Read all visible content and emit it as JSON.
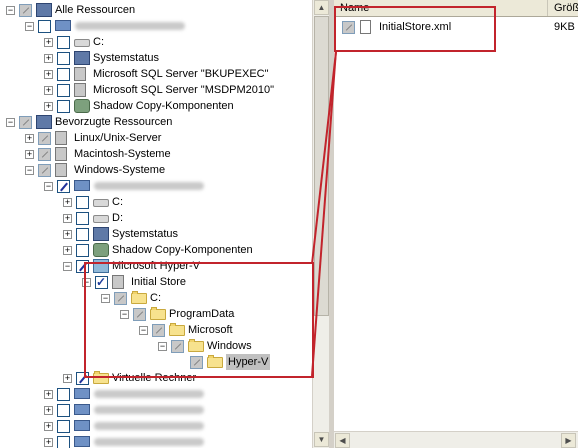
{
  "tree": {
    "nodes": [
      {
        "label": "Alle Ressourcen",
        "expander": "−",
        "check": "gray",
        "icon": "resources-icon"
      },
      {
        "label": "",
        "blurred": true,
        "expander": "−",
        "check": "empty",
        "icon": "computer-icon"
      },
      {
        "label": "C:",
        "expander": "+",
        "check": "empty",
        "icon": "drive-icon"
      },
      {
        "label": "Systemstatus",
        "expander": "+",
        "check": "empty",
        "icon": "system-state-icon"
      },
      {
        "label": "Microsoft SQL Server \"BKUPEXEC\"",
        "expander": "+",
        "check": "empty",
        "icon": "sql-server-icon"
      },
      {
        "label": "Microsoft SQL Server \"MSDPM2010\"",
        "expander": "+",
        "check": "empty",
        "icon": "sql-server-icon"
      },
      {
        "label": "Shadow Copy-Komponenten",
        "expander": "+",
        "check": "empty",
        "icon": "shadow-copy-icon"
      },
      {
        "label": "Bevorzugte Ressourcen",
        "expander": "−",
        "check": "gray",
        "icon": "resources-icon"
      },
      {
        "label": "Linux/Unix-Server",
        "expander": "+",
        "check": "gray",
        "icon": "server-icon"
      },
      {
        "label": "Macintosh-Systeme",
        "expander": "+",
        "check": "gray",
        "icon": "server-icon"
      },
      {
        "label": "Windows-Systeme",
        "expander": "−",
        "check": "gray",
        "icon": "server-icon"
      },
      {
        "label": "",
        "blurred": true,
        "expander": "−",
        "check": "slash",
        "icon": "computer-icon"
      },
      {
        "label": "C:",
        "expander": "+",
        "check": "empty",
        "icon": "drive-icon"
      },
      {
        "label": "D:",
        "expander": "+",
        "check": "empty",
        "icon": "drive-icon"
      },
      {
        "label": "Systemstatus",
        "expander": "+",
        "check": "empty",
        "icon": "system-state-icon"
      },
      {
        "label": "Shadow Copy-Komponenten",
        "expander": "+",
        "check": "empty",
        "icon": "shadow-copy-icon"
      },
      {
        "label": "Microsoft Hyper-V",
        "expander": "−",
        "check": "slash",
        "icon": "hyperv-icon"
      },
      {
        "label": "Initial Store",
        "expander": "−",
        "check": "checked",
        "icon": "store-icon"
      },
      {
        "label": "C:",
        "expander": "−",
        "check": "gray",
        "icon": "folder-icon"
      },
      {
        "label": "ProgramData",
        "expander": "−",
        "check": "gray",
        "icon": "folder-icon"
      },
      {
        "label": "Microsoft",
        "expander": "−",
        "check": "gray",
        "icon": "folder-icon"
      },
      {
        "label": "Windows",
        "expander": "−",
        "check": "gray",
        "icon": "folder-icon"
      },
      {
        "label": "Hyper-V",
        "expander": "",
        "check": "gray",
        "icon": "folder-icon",
        "selected": true
      },
      {
        "label": "Virtuelle Rechner",
        "expander": "+",
        "check": "slash",
        "icon": "folder-icon"
      },
      {
        "label": "",
        "blurred": true,
        "expander": "+",
        "check": "empty",
        "icon": "computer-icon"
      },
      {
        "label": "",
        "blurred": true,
        "expander": "+",
        "check": "empty",
        "icon": "computer-icon"
      },
      {
        "label": "",
        "blurred": true,
        "expander": "+",
        "check": "empty",
        "icon": "computer-icon"
      },
      {
        "label": "",
        "blurred": true,
        "expander": "+",
        "check": "empty",
        "icon": "computer-icon"
      }
    ]
  },
  "list": {
    "columns": [
      "Name",
      "Größe"
    ],
    "rows": [
      {
        "name": "InitialStore.xml",
        "size": "9KB",
        "check": "gray",
        "icon": "document-icon"
      }
    ]
  },
  "colors": {
    "highlight_box": "#c2242c",
    "chrome": "#ece9d8"
  }
}
